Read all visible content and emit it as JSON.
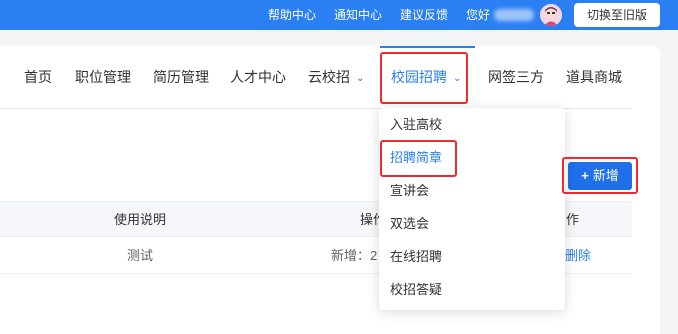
{
  "topbar": {
    "help": "帮助中心",
    "notice": "通知中心",
    "feedback": "建议反馈",
    "greeting": "您好",
    "switch_label": "切换至旧版"
  },
  "nav": {
    "items": [
      {
        "label": "首页"
      },
      {
        "label": "职位管理"
      },
      {
        "label": "简历管理"
      },
      {
        "label": "人才中心"
      },
      {
        "label": "云校招"
      },
      {
        "label": "校园招聘"
      },
      {
        "label": "网签三方"
      },
      {
        "label": "道具商城"
      }
    ]
  },
  "dropdown": {
    "items": [
      {
        "label": "入驻高校"
      },
      {
        "label": "招聘简章"
      },
      {
        "label": "宣讲会"
      },
      {
        "label": "双选会"
      },
      {
        "label": "在线招聘"
      },
      {
        "label": "校招答疑"
      }
    ]
  },
  "toolbar": {
    "add_label": "新增"
  },
  "table": {
    "columns": [
      "使用说明",
      "操作",
      "作"
    ],
    "rows": [
      {
        "usage": "测试",
        "op_text": "新增：2",
        "action": "删除"
      }
    ]
  },
  "colors": {
    "accent": "#2a7ff3",
    "highlight": "#f02a2a"
  }
}
